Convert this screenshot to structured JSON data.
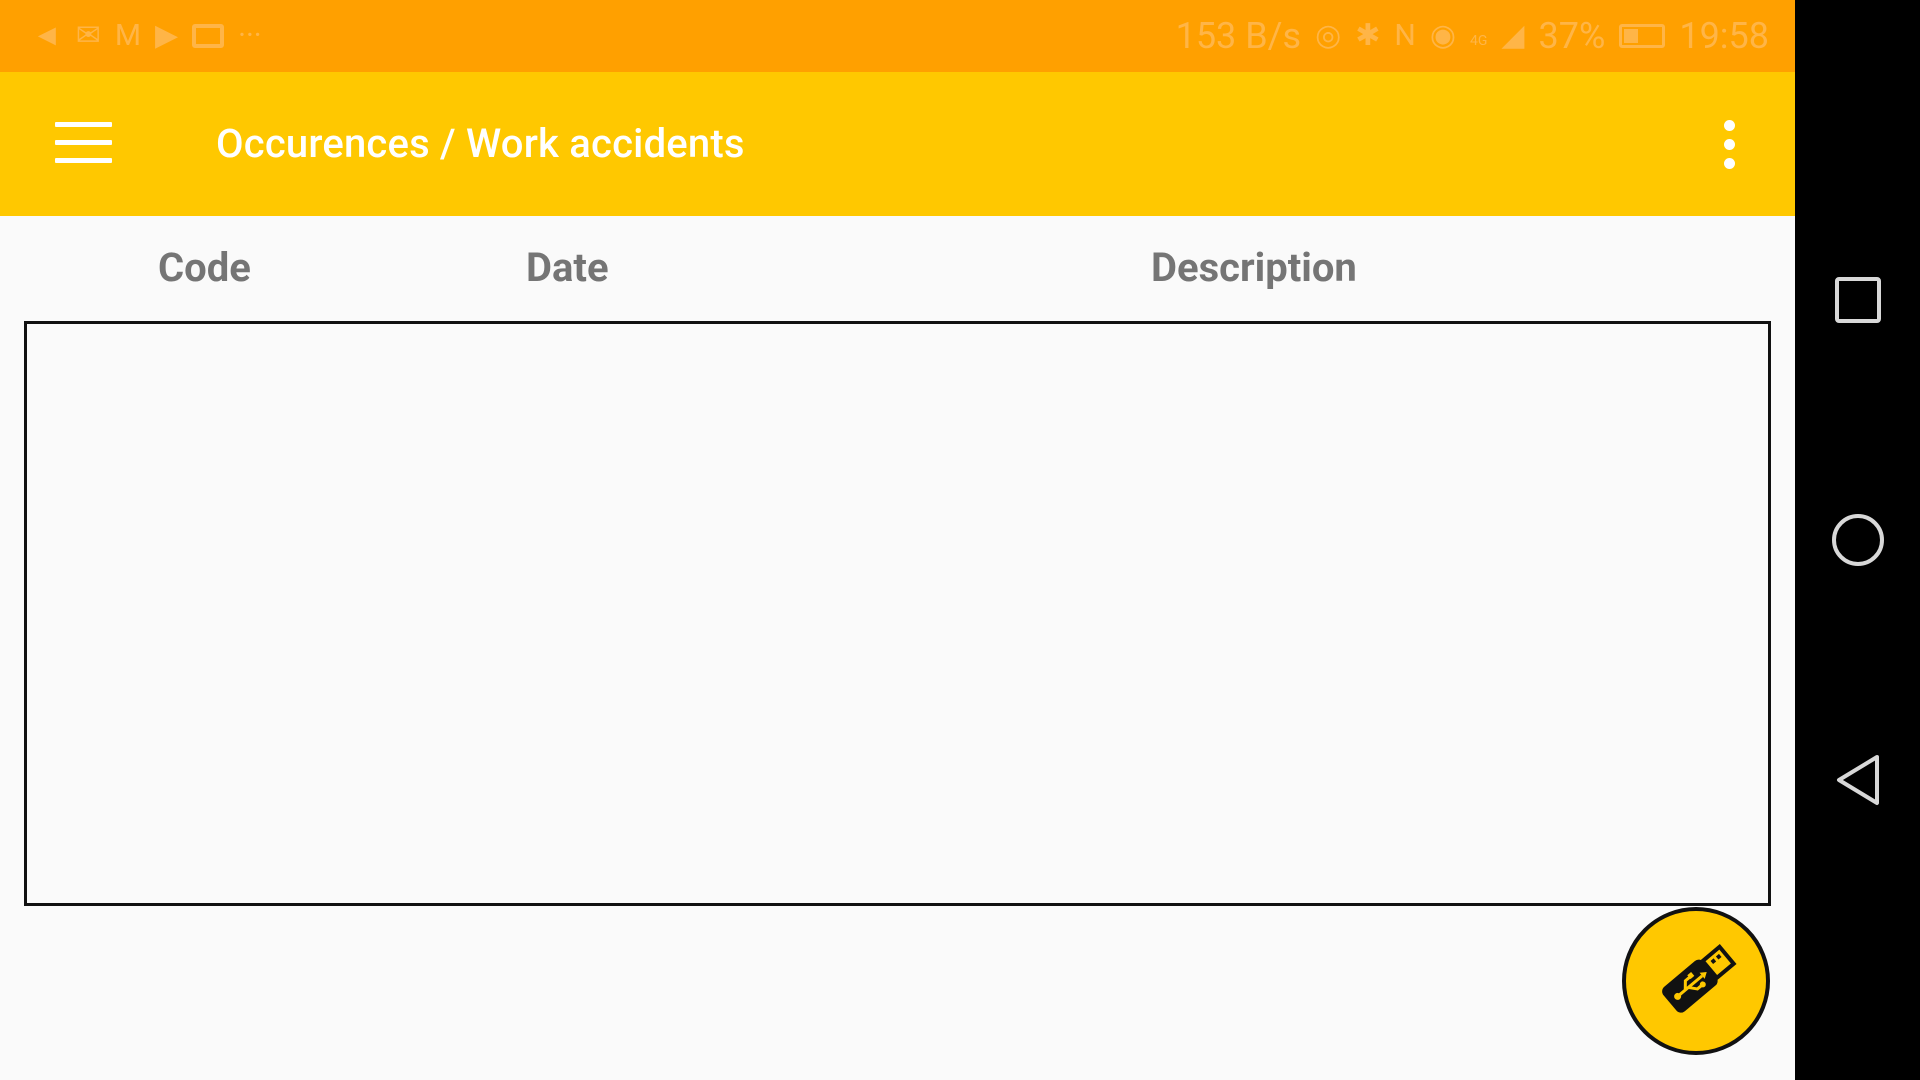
{
  "status_bar": {
    "network_speed": "153 B/s",
    "network_type": "4G",
    "battery_percent": "37%",
    "time": "19:58",
    "icons": [
      "google-plus-icon",
      "mail-icon",
      "gmail-icon",
      "youtube-icon",
      "calendar-icon",
      "more-notifications-icon",
      "hotspot-icon",
      "bluetooth-icon",
      "nfc-icon",
      "eye-comfort-icon",
      "signal-icon",
      "battery-icon"
    ]
  },
  "app_bar": {
    "title": "Occurences / Work accidents",
    "background": "#ffc800",
    "menu_icon": "hamburger-menu-icon",
    "overflow_icon": "more-vert-icon"
  },
  "table": {
    "columns": [
      "Code",
      "Date",
      "Description"
    ],
    "rows": []
  },
  "fab": {
    "icon": "usb-drive-icon",
    "color": "#ffc800"
  },
  "nav_bar": {
    "buttons": [
      "recent-apps-icon",
      "home-icon",
      "back-icon"
    ]
  }
}
